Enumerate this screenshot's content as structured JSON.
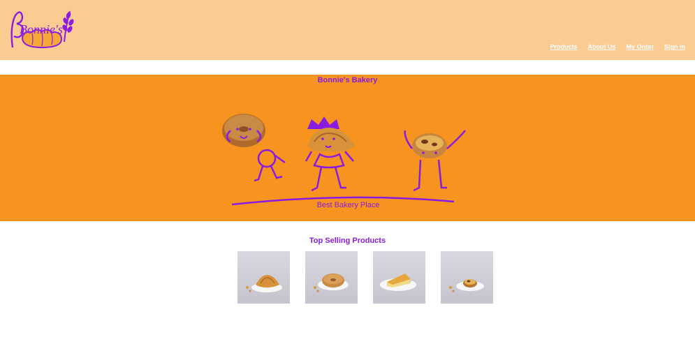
{
  "header": {
    "logo_text": "Bonnie's",
    "nav": [
      "Products",
      "About Us",
      "My Order",
      "Sign in"
    ]
  },
  "hero": {
    "title": "Bonnie's Bakery",
    "tagline": "Best Bakery Place"
  },
  "top_selling": {
    "title": "Top Selling Products",
    "products": [
      {
        "icon": "croissant-image"
      },
      {
        "icon": "bagel-image"
      },
      {
        "icon": "cheesecake-image"
      },
      {
        "icon": "egg-tart-image"
      }
    ]
  },
  "colors": {
    "header_bg": "#facc92",
    "hero_bg": "#f7941f",
    "accent_purple": "#8a1be0",
    "nav_text": "#ffffff"
  }
}
